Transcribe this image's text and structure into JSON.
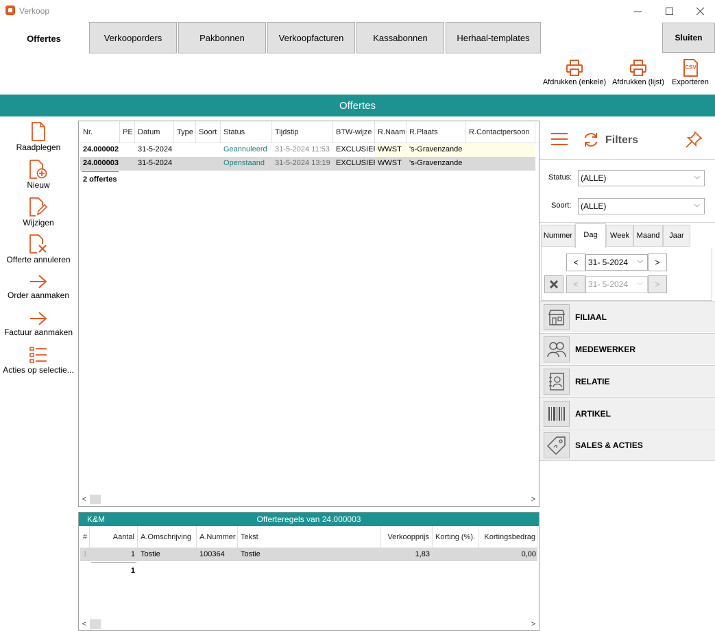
{
  "window": {
    "title": "Verkoop"
  },
  "tabs": {
    "active": "Offertes",
    "items": [
      "Verkooporders",
      "Pakbonnen",
      "Verkoopfacturen",
      "Kassabonnen",
      "Herhaal-templates"
    ],
    "close_label": "Sluiten"
  },
  "toolbar": {
    "print_single": "Afdrukken (enkele)",
    "print_list": "Afdrukken (lijst)",
    "export": "Exporteren",
    "csv_icon_text": "CSV"
  },
  "header": {
    "title": "Offertes"
  },
  "sidebar": {
    "items": [
      {
        "label": "Raadplegen",
        "icon": "document-icon"
      },
      {
        "label": "Nieuw",
        "icon": "document-plus-icon"
      },
      {
        "label": "Wijzigen",
        "icon": "document-edit-icon"
      },
      {
        "label": "Offerte annuleren",
        "icon": "document-cancel-icon"
      },
      {
        "label": "Order aanmaken",
        "icon": "arrow-right-icon"
      },
      {
        "label": "Factuur aanmaken",
        "icon": "arrow-right-icon"
      },
      {
        "label": "Acties op selectie...",
        "icon": "list-icon"
      }
    ]
  },
  "grid": {
    "columns": [
      "Nr.",
      "PE",
      "Datum",
      "Type",
      "Soort",
      "Status",
      "Tijdstip",
      "BTW-wijze",
      "R.Naam",
      "R.Plaats",
      "R.Contactpersoon"
    ],
    "rows": [
      {
        "nr": "24.000002",
        "pe": "",
        "datum": "31-5-2024",
        "type": "",
        "soort": "",
        "status": "Geannuleerd",
        "tijdstip": "31-5-2024 11:53",
        "btw": "EXCLUSIEF",
        "naam": "WWST",
        "plaats": "'s-Gravenzande",
        "contact": ""
      },
      {
        "nr": "24.000003",
        "pe": "",
        "datum": "31-5-2024",
        "type": "",
        "soort": "",
        "status": "Openstaand",
        "tijdstip": "31-5-2024 13:19",
        "btw": "EXCLUSIEF",
        "naam": "WWST",
        "plaats": "'s-Gravenzande",
        "contact": ""
      }
    ],
    "footer": "2 offertes",
    "scroll_left": "<",
    "scroll_right": ">"
  },
  "filters": {
    "title": "Filters",
    "status_label": "Status:",
    "status_value": "(ALLE)",
    "soort_label": "Soort:",
    "soort_value": "(ALLE)",
    "date_tabs": [
      "Nummer",
      "Dag",
      "Week",
      "Maand",
      "Jaar"
    ],
    "active_date_tab": "Dag",
    "date_from": "31-  5-2024",
    "date_to": "31-  5-2024",
    "prev": "<",
    "next": ">",
    "sections": [
      {
        "label": "FILIAAL",
        "icon": "store-icon"
      },
      {
        "label": "MEDEWERKER",
        "icon": "people-icon"
      },
      {
        "label": "RELATIE",
        "icon": "contact-card-icon"
      },
      {
        "label": "ARTIKEL",
        "icon": "barcode-icon"
      },
      {
        "label": "SALES & ACTIES",
        "icon": "price-tag-icon"
      }
    ]
  },
  "lines": {
    "company": "K&M",
    "title": "Offerteregels van 24.000003",
    "columns": [
      "#",
      "Aantal",
      "A.Omschrijving",
      "A.Nummer",
      "Tekst",
      "Verkoopprijs",
      "Korting (%).",
      "Kortingsbedrag"
    ],
    "rows": [
      {
        "idx": "1",
        "aantal": "1",
        "omschrijving": "Tostie",
        "nummer": "100364",
        "tekst": "Tostie",
        "prijs": "1,83",
        "korting": "",
        "bedrag": "0,00"
      }
    ],
    "total": "1"
  },
  "colors": {
    "accent": "#1c9391",
    "icon_orange": "#e05a23",
    "status_text": "#1c7f7d"
  }
}
